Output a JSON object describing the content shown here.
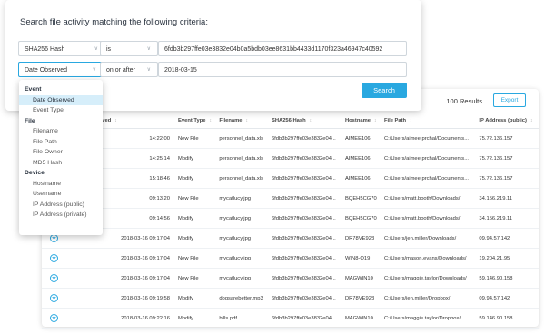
{
  "search": {
    "title": "Search file activity matching the following criteria:",
    "row1": {
      "field": "SHA256 Hash",
      "operator": "is",
      "value": "6fdb3b297ffe03e3832e04b0a5bdb03ee8631bb4433d1170f323a46947c40592"
    },
    "row2": {
      "field": "Date Observed",
      "operator": "on or after",
      "value": "2018-03-15"
    },
    "button": "Search"
  },
  "dropdown": {
    "groups": [
      {
        "label": "Event",
        "items": [
          "Date Observed",
          "Event Type"
        ]
      },
      {
        "label": "File",
        "items": [
          "Filename",
          "File Path",
          "File Owner",
          "MD5 Hash"
        ]
      },
      {
        "label": "Device",
        "items": [
          "Hostname",
          "Username",
          "IP Address (public)",
          "IP Address (private)"
        ]
      }
    ],
    "selected": "Date Observed"
  },
  "results": {
    "count": "100 Results",
    "export": "Export",
    "columns": [
      "rved",
      "Event Type",
      "Filename",
      "SHA256 Hash",
      "Hostname",
      "File Path",
      "IP Address (public)"
    ],
    "rows": [
      {
        "date": "14:22:00",
        "event": "New File",
        "file": "personnel_data.xls",
        "hash": "6fdb3b297ffe03e3832e04...",
        "host": "AIMEE106",
        "path": "C:/Users/aimee.prchal/Documents...",
        "ip": "75.72.136.157"
      },
      {
        "date": "14:25:14",
        "event": "Modify",
        "file": "personnel_data.xls",
        "hash": "6fdb3b297ffe03e3832e04...",
        "host": "AIMEE106",
        "path": "C:/Users/aimee.prchal/Documents...",
        "ip": "75.72.136.157"
      },
      {
        "date": "15:18:46",
        "event": "Modify",
        "file": "personnel_data.xls",
        "hash": "6fdb3b297ffe03e3832e04...",
        "host": "AIMEE106",
        "path": "C:/Users/aimee.prchal/Documents...",
        "ip": "75.72.136.157"
      },
      {
        "date": "09:13:20",
        "event": "New File",
        "file": "mycatlucy.jpg",
        "hash": "6fdb3b297ffe03e3832e04...",
        "host": "BQEH5CG70",
        "path": "C:/Users/matt.booth/Downloads/",
        "ip": "34.156.219.11"
      },
      {
        "date": "09:14:56",
        "event": "Modify",
        "file": "mycatlucy.jpg",
        "hash": "6fdb3b297ffe03e3832e04...",
        "host": "BQEH5CG70",
        "path": "C:/Users/matt.booth/Downloads/",
        "ip": "34.156.219.11"
      },
      {
        "date": "2018-03-16 09:17:04",
        "event": "Modify",
        "file": "mycatlucy.jpg",
        "hash": "6fdb3b297ffe03e3832e04...",
        "host": "DR78VE923",
        "path": "C:/Users/jen.miller/Downloads/",
        "ip": "09.94.57.142"
      },
      {
        "date": "2018-03-16 09:17:04",
        "event": "New File",
        "file": "mycatlucy.jpg",
        "hash": "6fdb3b297ffe03e3832e04...",
        "host": "WIN8-Q19",
        "path": "C:/Users/mason.evans/Downloads/",
        "ip": "19.204.21.95"
      },
      {
        "date": "2018-03-16 09:17:04",
        "event": "New File",
        "file": "mycatlucy.jpg",
        "hash": "6fdb3b297ffe03e3832e04...",
        "host": "MAGWIN10",
        "path": "C:/Users/maggie.taylor/Downloads/",
        "ip": "59.146.90.158"
      },
      {
        "date": "2018-03-16 09:19:58",
        "event": "Modify",
        "file": "dogsarebetter.mp3",
        "hash": "6fdb3b297ffe03e3832e04...",
        "host": "DR78VE923",
        "path": "C:/Users/jen.miller/Dropbox/",
        "ip": "09.94.57.142"
      },
      {
        "date": "2018-03-16 09:22:16",
        "event": "Modify",
        "file": "bills.pdf",
        "hash": "6fdb3b297ffe03e3832e04...",
        "host": "MAGWIN10",
        "path": "C:/Users/maggie.taylor/Dropbox/",
        "ip": "59.146.90.158"
      }
    ]
  },
  "colors": {
    "accent": "#29a8e0",
    "selected_bg": "#d6eefa"
  }
}
